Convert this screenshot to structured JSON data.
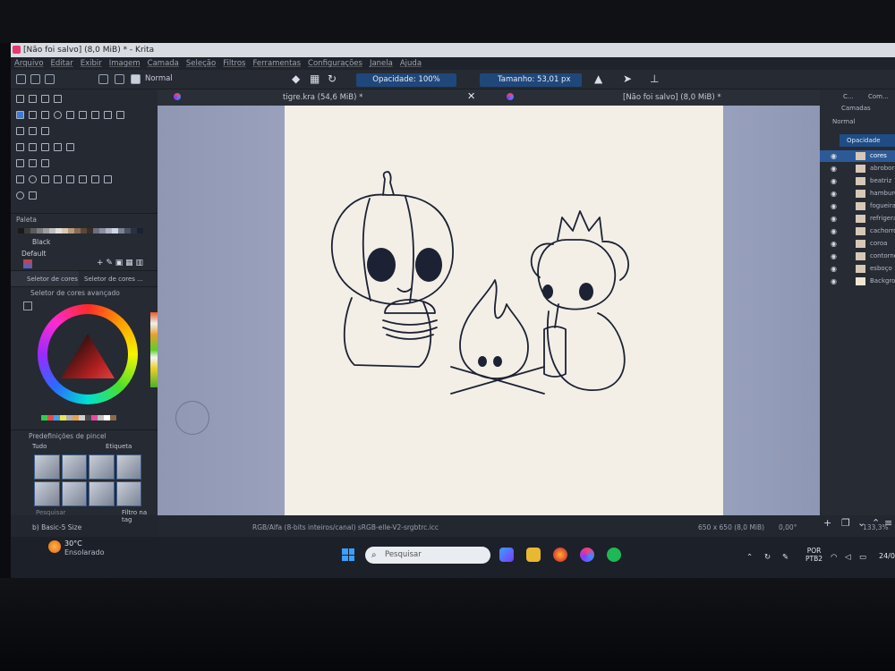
{
  "window": {
    "title": "[Não foi salvo]  (8,0 MiB) * - Krita"
  },
  "menu": [
    "Arquivo",
    "Editar",
    "Exibir",
    "Imagem",
    "Camada",
    "Seleção",
    "Filtros",
    "Ferramentas",
    "Configurações",
    "Janela",
    "Ajuda"
  ],
  "toolbar": {
    "blend_mode": "Normal",
    "opacity": "Opacidade: 100%",
    "size": "Tamanho: 53,01 px"
  },
  "tabs": [
    {
      "label": "tigre.kra (54,6 MiB) *"
    },
    {
      "label": "[Não foi salvo]  (8,0 MiB) *"
    }
  ],
  "palette": {
    "title": "Paleta",
    "color_name": "Black",
    "preset": "Default"
  },
  "color_tabs": [
    "Seletor de cores ...",
    "Seletor de cores ..."
  ],
  "advanced_selector": {
    "title": "Seletor de cores avançado"
  },
  "brush_presets": {
    "title": "Predefinições de pincel",
    "filter": "Tudo",
    "tag": "Etiqueta",
    "search_placeholder": "Pesquisar",
    "filter_tag": "Filtro na tag",
    "current": "b) Basic-5 Size"
  },
  "status": {
    "color_space": "RGB/Alfa (8-bits inteiros/canal)  sRGB-elle-V2-srgbtrc.icc",
    "doc_size": "650 x 650 (8,0 MiB)",
    "rotation": "0,00°",
    "zoom": "133,3%"
  },
  "layers": {
    "tabs": [
      "C...",
      "Com..."
    ],
    "title": "Camadas",
    "blend_mode": "Normal",
    "opacity_label": "Opacidade",
    "items": [
      {
        "name": "cores",
        "active": true
      },
      {
        "name": "abrobora",
        "active": false
      },
      {
        "name": "beatriz",
        "active": false
      },
      {
        "name": "hamburguer",
        "active": false
      },
      {
        "name": "fogueira",
        "active": false
      },
      {
        "name": "refrigerante",
        "active": false
      },
      {
        "name": "cachorro",
        "active": false
      },
      {
        "name": "coroa",
        "active": false
      },
      {
        "name": "contorno",
        "active": false
      },
      {
        "name": "esboço",
        "active": false
      },
      {
        "name": "Background",
        "active": false
      }
    ]
  },
  "taskbar": {
    "weather_temp": "30°C",
    "weather_desc": "Ensolarado",
    "search_placeholder": "Pesquisar",
    "language_line1": "POR",
    "language_line2": "PTB2",
    "date_fragment": "24/0"
  },
  "colors": {
    "accent": "#20477a",
    "canvas_bg": "#a3abc6",
    "paper": "#f3efe7",
    "line_art": "#1c2233"
  }
}
